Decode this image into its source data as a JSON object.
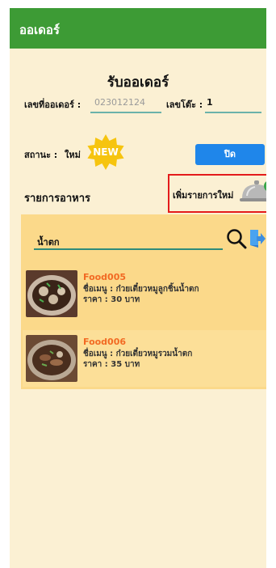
{
  "topbar": {
    "title": "ออเดอร์"
  },
  "page": {
    "title": "รับออเดอร์"
  },
  "order": {
    "number_label": "เลขที่ออเดอร์ :",
    "number_value": "023012124",
    "table_label": "เลขโต๊ะ :",
    "table_value": "1",
    "status_label": "สถานะ :",
    "status_value": "ใหม่",
    "status_badge": "NEW",
    "close_button": "ปิด"
  },
  "menu": {
    "section_title": "รายการอาหาร",
    "add_label": "เพิ่มรายการใหม่",
    "search_value": "น้ำตก",
    "items": [
      {
        "id": "Food005",
        "name": "ชื่อเมนู : ก๋วยเตี๋ยวหมูลูกชิ้นน้ำตก",
        "price": "ราคา : 30 บาท"
      },
      {
        "id": "Food006",
        "name": "ชื่อเมนู : ก๋วยเตี๋ยวหมูรวมน้ำตก",
        "price": "ราคา : 35 บาท"
      }
    ]
  },
  "colors": {
    "topbar": "#3d9b35",
    "background": "#fbf0d3",
    "panel": "#fbd98a",
    "button": "#1f86ea",
    "badge": "#f6c40f",
    "item_id": "#f26a23",
    "highlight": "#e41b1b"
  },
  "icons": [
    "new-badge-icon",
    "cloche-add-icon",
    "search-icon",
    "exit-icon"
  ]
}
